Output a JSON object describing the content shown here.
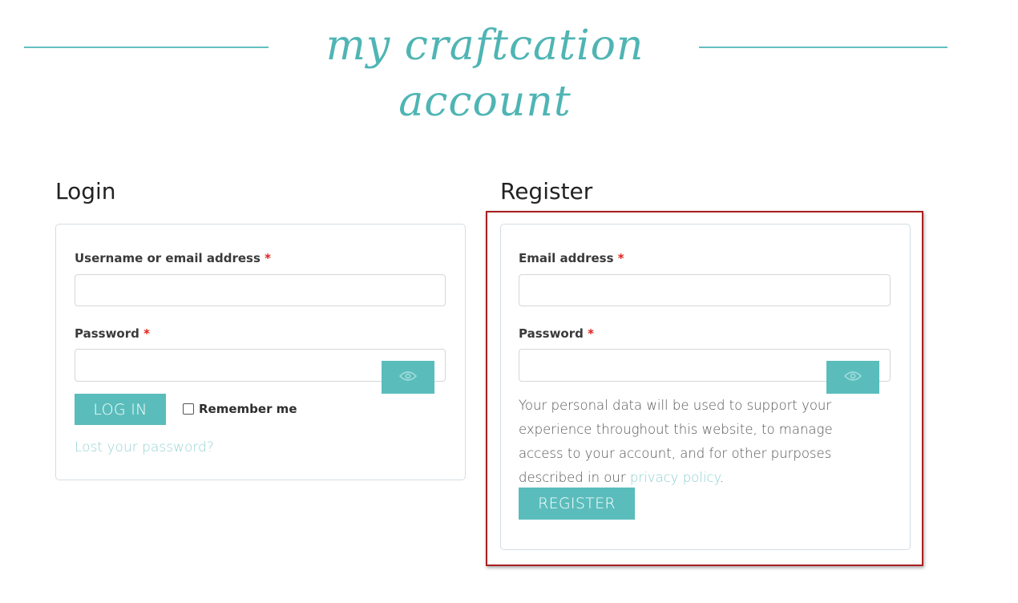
{
  "header": {
    "title": "my craftcation account"
  },
  "login": {
    "heading": "Login",
    "username_label": "Username or email address",
    "username_value": "",
    "password_label": "Password",
    "password_value": "",
    "required_mark": "*",
    "login_button": "LOG IN",
    "remember_label": "Remember me",
    "remember_checked": false,
    "lost_password_link": "Lost your password?"
  },
  "register": {
    "heading": "Register",
    "email_label": "Email address",
    "email_value": "",
    "password_label": "Password",
    "password_value": "",
    "required_mark": "*",
    "privacy_text": "Your personal data will be used to support your experience throughout this website, to manage access to your account, and for other purposes described in our",
    "privacy_link": "privacy policy",
    "privacy_end": ".",
    "register_button": "REGISTER"
  },
  "icons": {
    "show_password": "eye-icon"
  },
  "colors": {
    "accent": "#5abdbc",
    "link": "#8ccfcf",
    "required": "#e0211c",
    "highlight": "#a81f1f"
  }
}
